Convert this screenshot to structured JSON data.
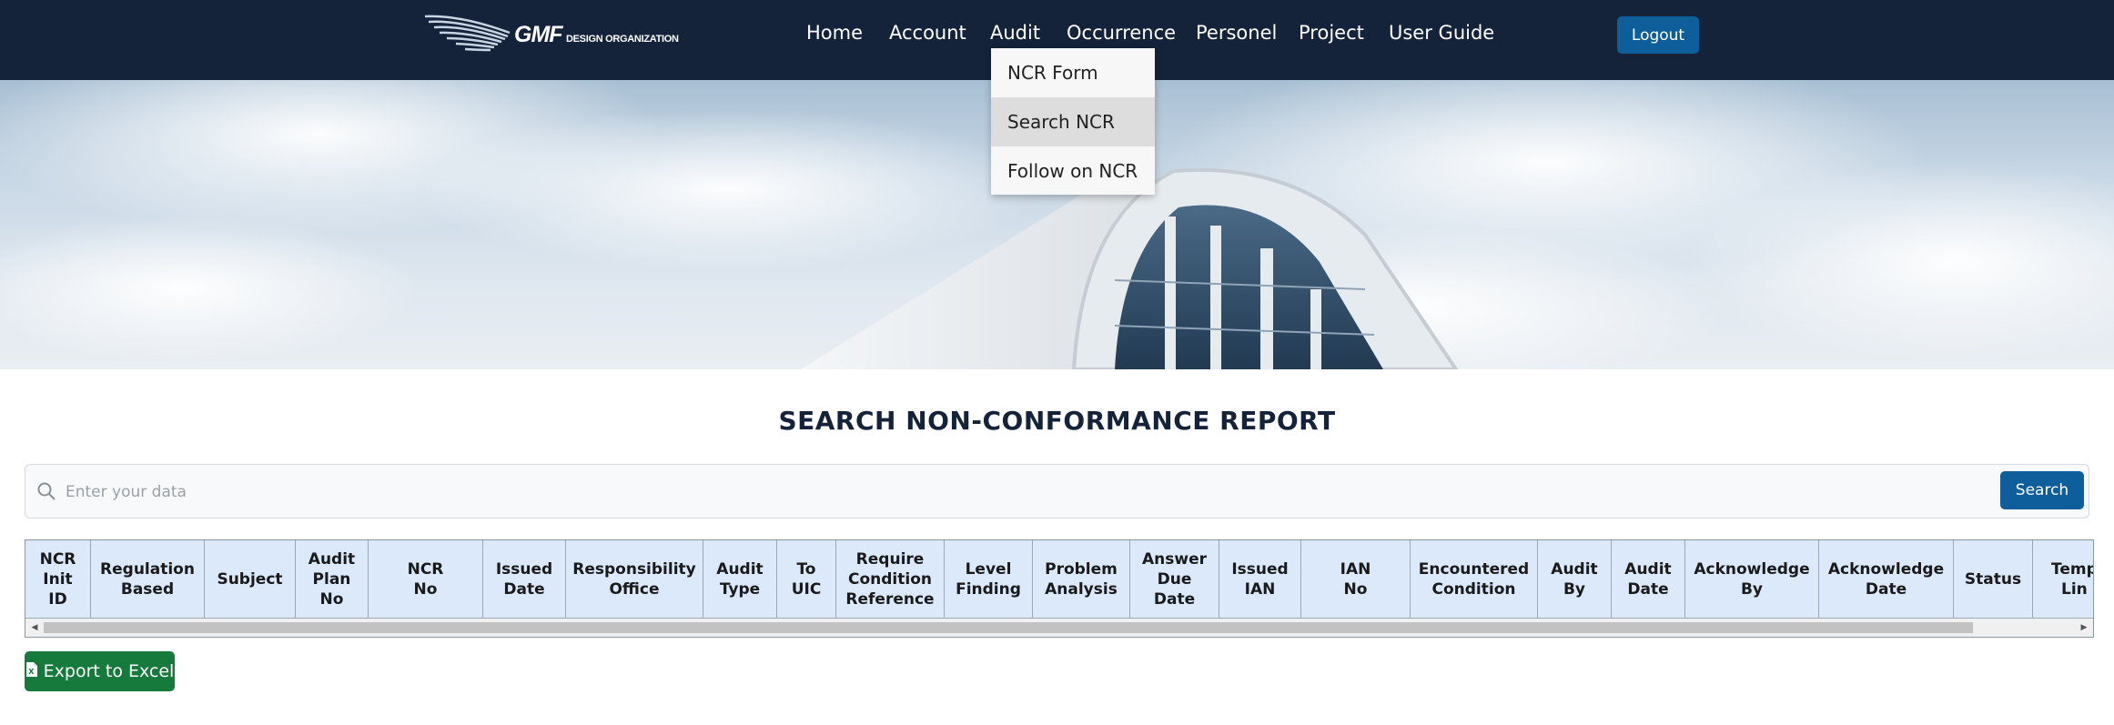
{
  "brand": {
    "logo_main": "GMF",
    "logo_sub": "DESIGN ORGANIZATION"
  },
  "nav": {
    "items": [
      "Home",
      "Account",
      "Audit",
      "Occurrence",
      "Personel",
      "Project",
      "User Guide"
    ],
    "logout": "Logout"
  },
  "dropdown": {
    "items": [
      "NCR Form",
      "Search NCR",
      "Follow on NCR"
    ],
    "active": "Search NCR"
  },
  "page": {
    "title": "SEARCH NON-CONFORMANCE REPORT"
  },
  "search": {
    "placeholder": "Enter your data",
    "value": "",
    "button": "Search"
  },
  "table": {
    "headers": [
      "NCR\nInit\nID",
      "Regulation\nBased",
      "Subject",
      "Audit\nPlan\nNo",
      "NCR\nNo",
      "Issued\nDate",
      "Responsibility\nOffice",
      "Audit\nType",
      "To\nUIC",
      "Require\nCondition\nReference",
      "Level\nFinding",
      "Problem\nAnalysis",
      "Answer\nDue\nDate",
      "Issued\nIAN",
      "IAN\nNo",
      "Encountered\nCondition",
      "Audit\nBy",
      "Audit\nDate",
      "Acknowledge\nBy",
      "Acknowledge\nDate",
      "Status",
      "Temp\nLin"
    ],
    "rows": []
  },
  "export": {
    "label": "Export to Excel"
  },
  "colors": {
    "navbar": "#14233a",
    "primary": "#0d5e9b",
    "export": "#157a3c",
    "header_bg": "#dbe9fb"
  }
}
